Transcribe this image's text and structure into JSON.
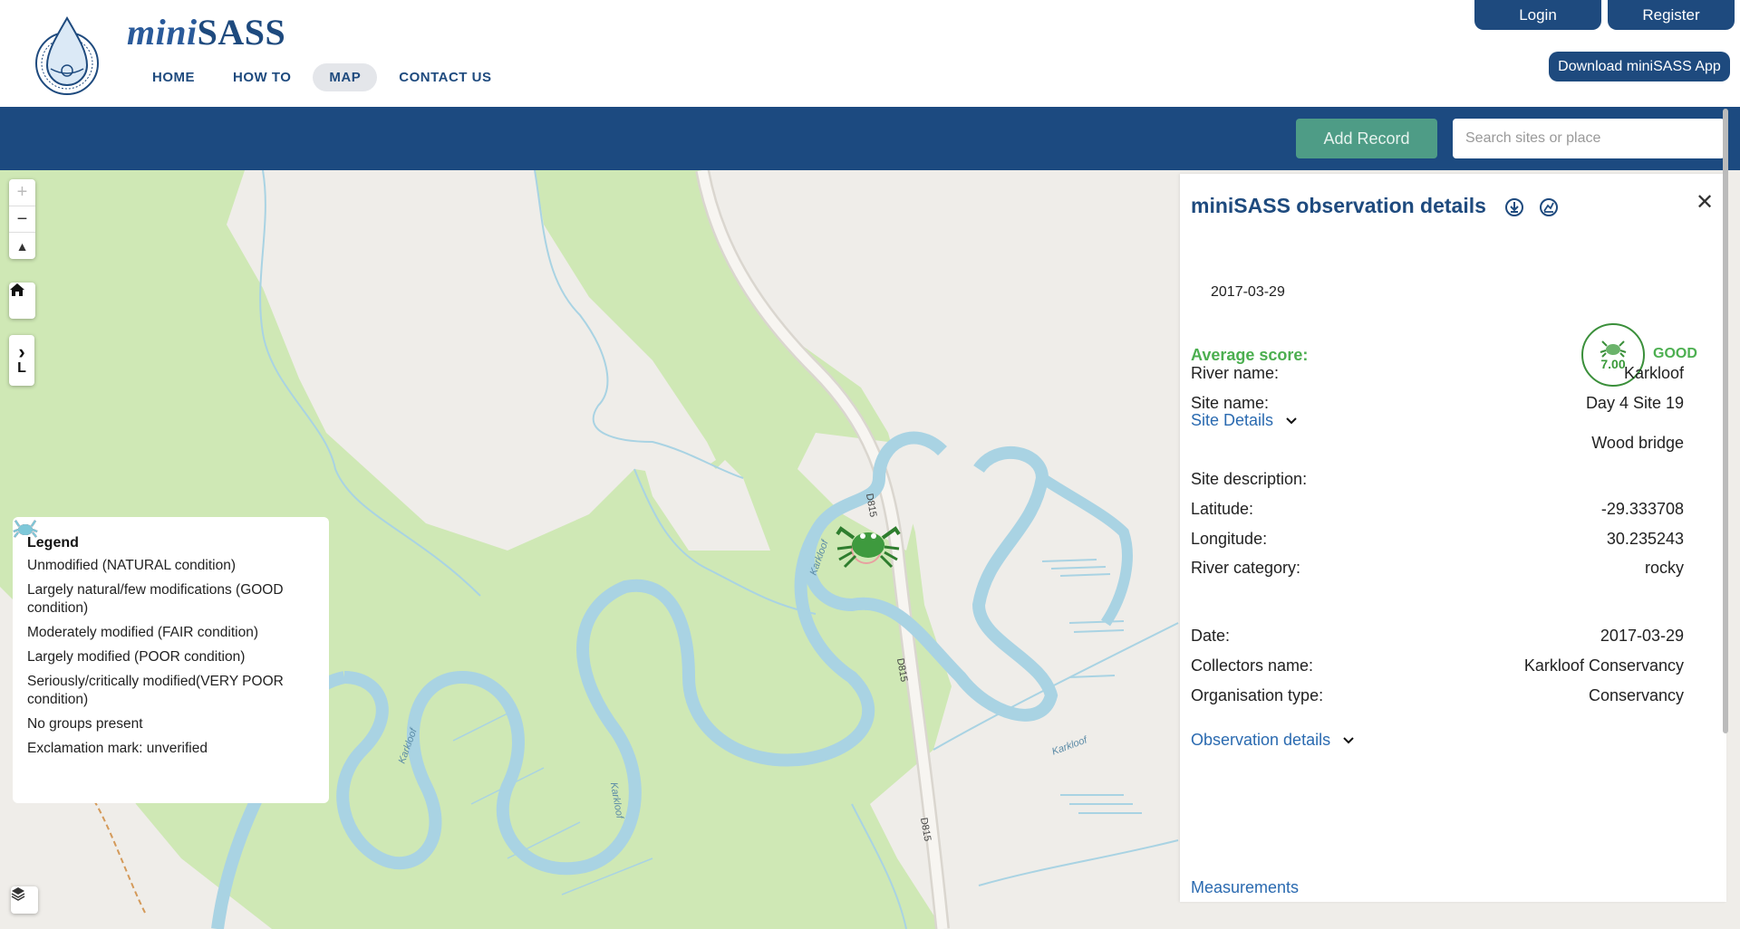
{
  "header": {
    "brand_prefix": "mini",
    "brand_suffix": "SASS",
    "nav": [
      {
        "label": "HOME"
      },
      {
        "label": "HOW TO"
      },
      {
        "label": "MAP"
      },
      {
        "label": "CONTACT US"
      }
    ],
    "login_label": "Login",
    "register_label": "Register",
    "download_label": "Download miniSASS App"
  },
  "toolbar": {
    "add_record_label": "Add Record",
    "search_placeholder": "Search sites or place"
  },
  "map": {
    "road_label": "D815",
    "river_label": "Karkloof",
    "zoom_in": "+",
    "zoom_out": "−",
    "reset_north": "▲",
    "legend_toggle_arrow": "›",
    "legend_toggle_letter": "L"
  },
  "legend": {
    "title": "Legend",
    "items": [
      {
        "label": "Unmodified (NATURAL condition)",
        "color": "#2f4fc9"
      },
      {
        "label": "Largely natural/few modifications (GOOD condition)",
        "color": "#6bb36b"
      },
      {
        "label": "Moderately modified (FAIR condition)",
        "color": "#f5a623"
      },
      {
        "label": "Largely modified (POOR condition)",
        "color": "#e0452c"
      },
      {
        "label": "Seriously/critically modified(VERY POOR condition)",
        "color": "#9b59b6"
      },
      {
        "label": "No groups present",
        "color": "#9e9e9e"
      },
      {
        "label": "Exclamation mark: unverified",
        "color": "#7ec8d9"
      }
    ]
  },
  "panel": {
    "title": "miniSASS observation details",
    "date": "2017-03-29",
    "average_score_label": "Average score:",
    "average_score": "7.00",
    "condition": "GOOD",
    "site_details_label": "Site Details",
    "site_rows": [
      {
        "label": "River name:",
        "value": "Karkloof"
      },
      {
        "label": "Site name:",
        "value": "Day 4 Site 19"
      },
      {
        "label": "",
        "value": "Wood bridge"
      },
      {
        "label": "Site description:",
        "value": ""
      },
      {
        "label": "Latitude:",
        "value": "-29.333708"
      },
      {
        "label": "Longitude:",
        "value": "30.235243"
      },
      {
        "label": "River category:",
        "value": "rocky"
      }
    ],
    "observation_details_label": "Observation details",
    "obs_rows": [
      {
        "label": "Date:",
        "value": "2017-03-29"
      },
      {
        "label": "Collectors name:",
        "value": "Karkloof Conservancy"
      },
      {
        "label": "Organisation type:",
        "value": "Conservancy"
      }
    ],
    "measurements_label": "Measurements"
  },
  "colors": {
    "brand_blue": "#1e4a7e",
    "toolbar_blue": "#1c4a80",
    "good_green": "#4caf50",
    "forest": "#cfe8b5",
    "river": "#a9d3e3"
  },
  "icons": [
    "minisass-logo",
    "download-icon",
    "chart-icon",
    "close-icon",
    "home-icon",
    "layers-icon",
    "chevron-down-icon",
    "crab-icon"
  ]
}
